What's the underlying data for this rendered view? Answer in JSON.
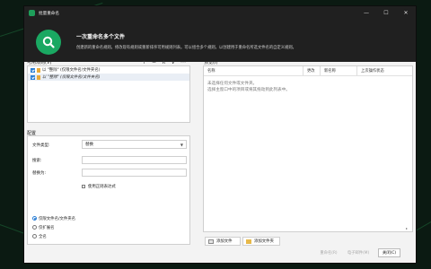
{
  "window": {
    "title": "批量重命名",
    "controls": {
      "minimize": "—",
      "maximize": "☐",
      "close": "✕"
    }
  },
  "header": {
    "heading": "一次重命名多个文件",
    "description": "创建新的重命名规则。修改现有规则或重新排序可用规则列表。可以组合多个规则，以创建用于重命名所选文件名的自定义规则。"
  },
  "rules": {
    "title": "可用规则(V)",
    "toolbar": {
      "add": "+",
      "remove": "−",
      "up": "∧",
      "down": "∨",
      "more": "⋯"
    },
    "items": [
      {
        "label": "以 \"整除\" (仅限文件名/文件夹名)"
      },
      {
        "label": "以 \"整除\" (仅限文件名/文件夹名)"
      }
    ]
  },
  "config": {
    "title": "配置",
    "file_type_label": "文件类型:",
    "file_type_value": "替换",
    "search_label": "搜索:",
    "replace_label": "替换为:",
    "regex_label": "使用正则表达式",
    "scope_options": [
      {
        "label": "仅限文件名/文件夹名",
        "selected": true
      },
      {
        "label": "仅扩展名",
        "selected": false
      },
      {
        "label": "全名",
        "selected": false
      }
    ]
  },
  "preview": {
    "title": "预览(I)",
    "columns": [
      "名称",
      "更改",
      "新名称",
      "上次操作状态"
    ],
    "empty_line1": "未选择任何文件或文件夹。",
    "empty_line2": "选择主窗口中的项目或将其拖动到此列表中。"
  },
  "footer": {
    "add_files": "添加文件",
    "add_folders": "添加文件夹",
    "rename": "重命名(R)",
    "email": "电子邮件(M)",
    "close": "关闭(C)"
  },
  "colors": {
    "accent": "#1aa862",
    "chrome": "#202020",
    "selection": "#2b7fd6"
  }
}
